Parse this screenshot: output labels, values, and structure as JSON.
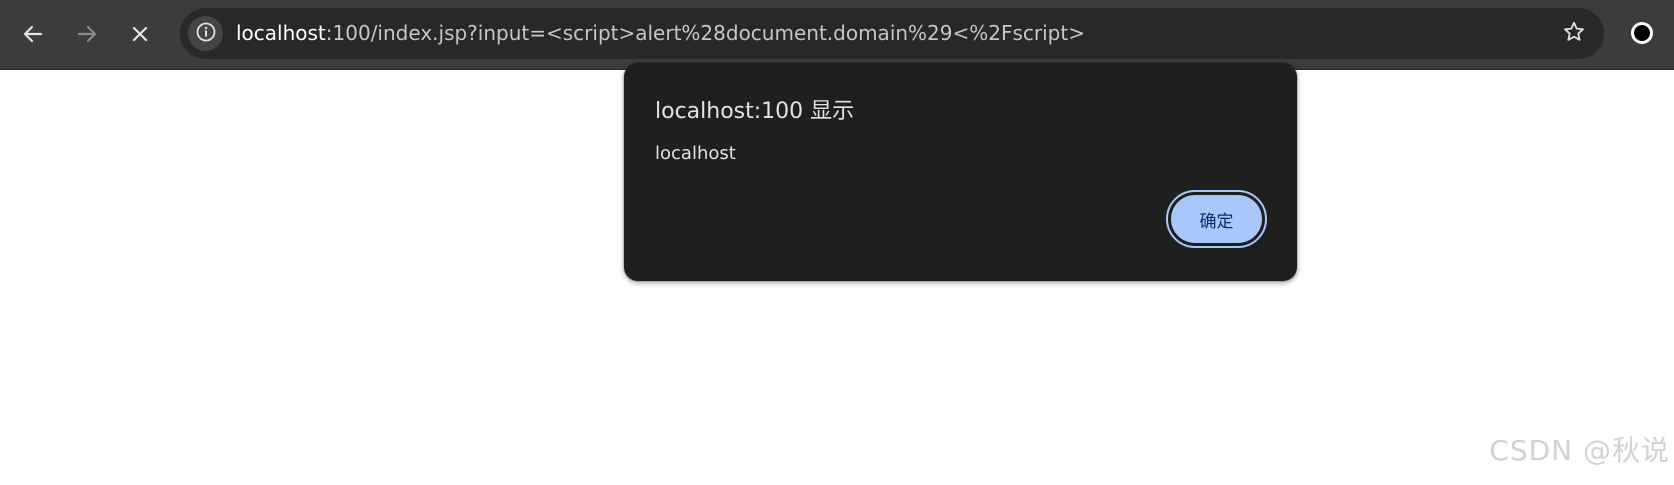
{
  "browser": {
    "url": {
      "host": "localhost",
      "rest": ":100/index.jsp?input=<script>alert%28document.domain%29<%2Fscript>"
    }
  },
  "dialog": {
    "title": "localhost:100 显示",
    "message": "localhost",
    "ok_label": "确定"
  },
  "watermark": {
    "text": "CSDN @秋说"
  },
  "colors": {
    "toolbar_bg": "#3c3c3c",
    "omnibox_bg": "#282828",
    "dialog_bg": "#1f1f1f",
    "button_bg": "#a8c7fa",
    "button_text": "#062e6f"
  },
  "icons": {
    "back": "arrow-left-icon",
    "forward": "arrow-right-icon",
    "stop": "close-icon",
    "site_info": "info-icon",
    "bookmark": "star-icon",
    "profile": "profile-icon"
  }
}
